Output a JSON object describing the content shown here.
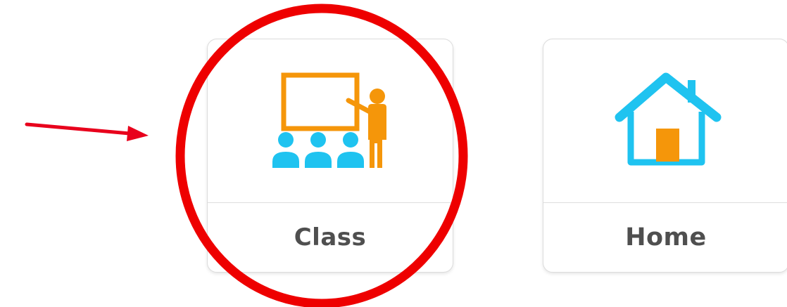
{
  "cards": [
    {
      "label": "Class",
      "icon": "teacher-classroom-icon"
    },
    {
      "label": "Home",
      "icon": "house-icon"
    }
  ],
  "annotation": {
    "arrow_color": "#e8001c",
    "circle_color": "#ee0000"
  },
  "colors": {
    "orange": "#f5960a",
    "blue": "#1fc3f0",
    "label_text": "#4f4f4f"
  }
}
